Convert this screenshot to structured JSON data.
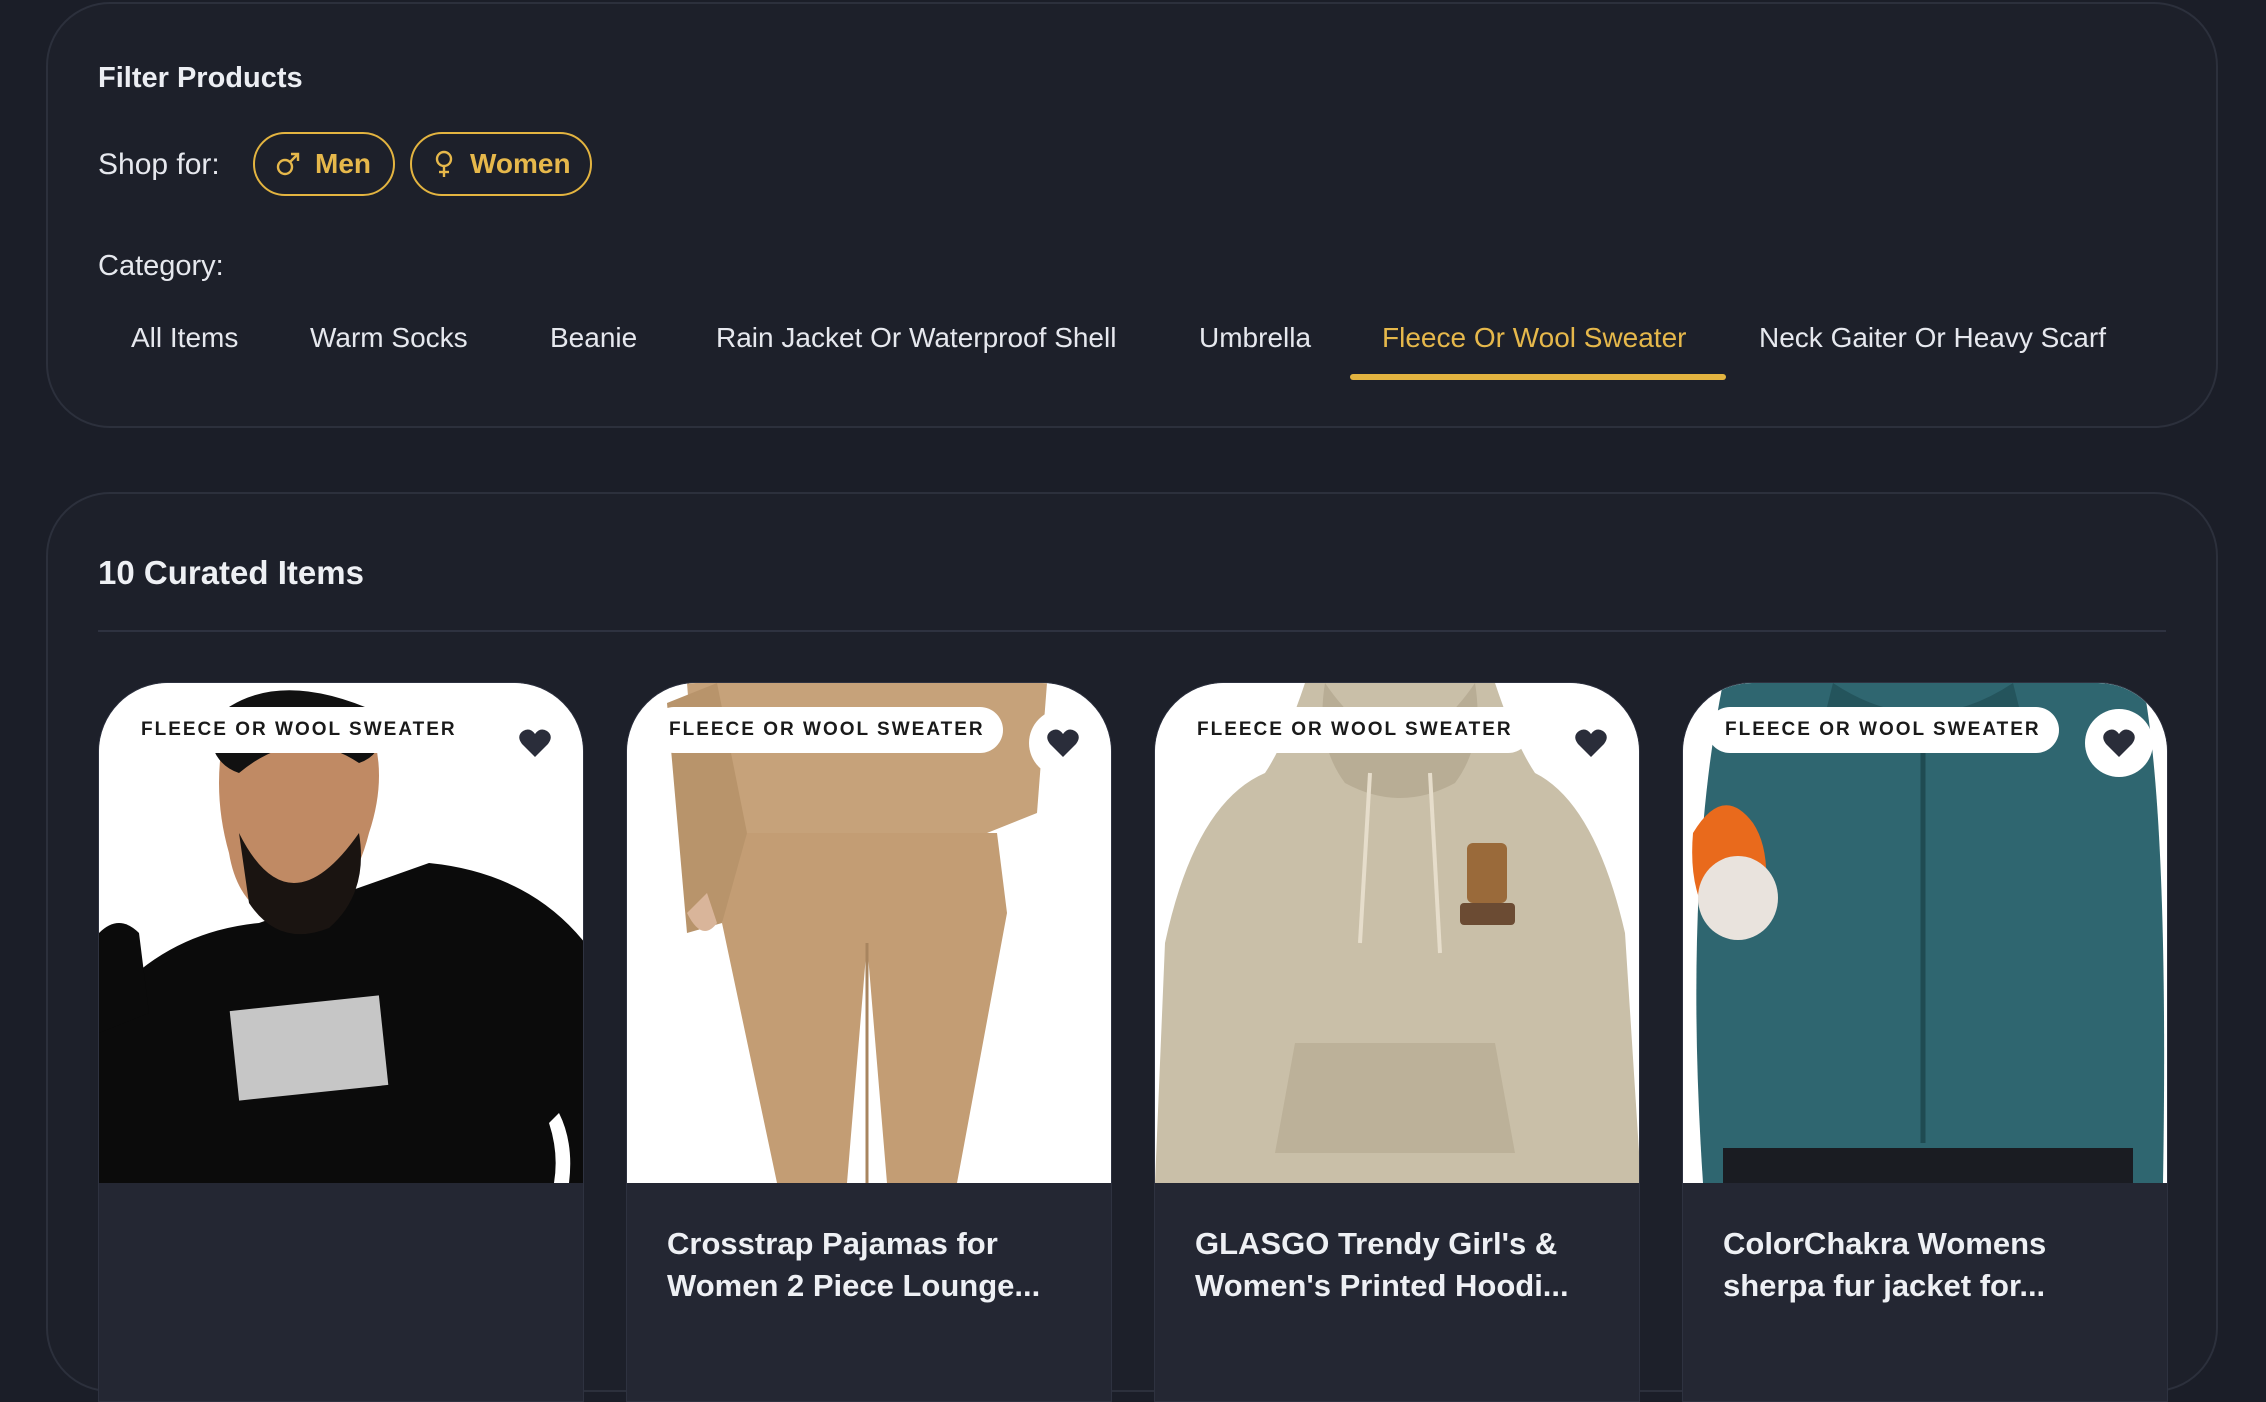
{
  "filter": {
    "title": "Filter Products",
    "shop_for_label": "Shop for:",
    "genders": [
      {
        "label": "Men",
        "icon": "male-symbol-icon"
      },
      {
        "label": "Women",
        "icon": "female-symbol-icon"
      }
    ],
    "category_label": "Category:",
    "categories": [
      {
        "label": "All Items"
      },
      {
        "label": "Warm Socks"
      },
      {
        "label": "Beanie"
      },
      {
        "label": "Rain Jacket Or Waterproof Shell"
      },
      {
        "label": "Umbrella"
      },
      {
        "label": "Fleece Or Wool Sweater",
        "active": true
      },
      {
        "label": "Neck Gaiter Or Heavy Scarf"
      }
    ],
    "accent_color": "#e3b440"
  },
  "products": {
    "title": "10 Curated Items",
    "cards": [
      {
        "badge": "FLEECE OR WOOL SWEATER",
        "title": "",
        "image": "man-black-sweatshirt-photo"
      },
      {
        "badge": "FLEECE OR WOOL SWEATER",
        "title": "Crosstrap Pajamas for Women 2 Piece Lounge...",
        "image": "tan-pajama-set-photo"
      },
      {
        "badge": "FLEECE OR WOOL SWEATER",
        "title": "GLASGO Trendy Girl's & Women's Printed Hoodi...",
        "image": "beige-hoodie-photo"
      },
      {
        "badge": "FLEECE OR WOOL SWEATER",
        "title": "ColorChakra Womens sherpa fur jacket for...",
        "image": "teal-sherpa-jacket-photo"
      }
    ]
  }
}
